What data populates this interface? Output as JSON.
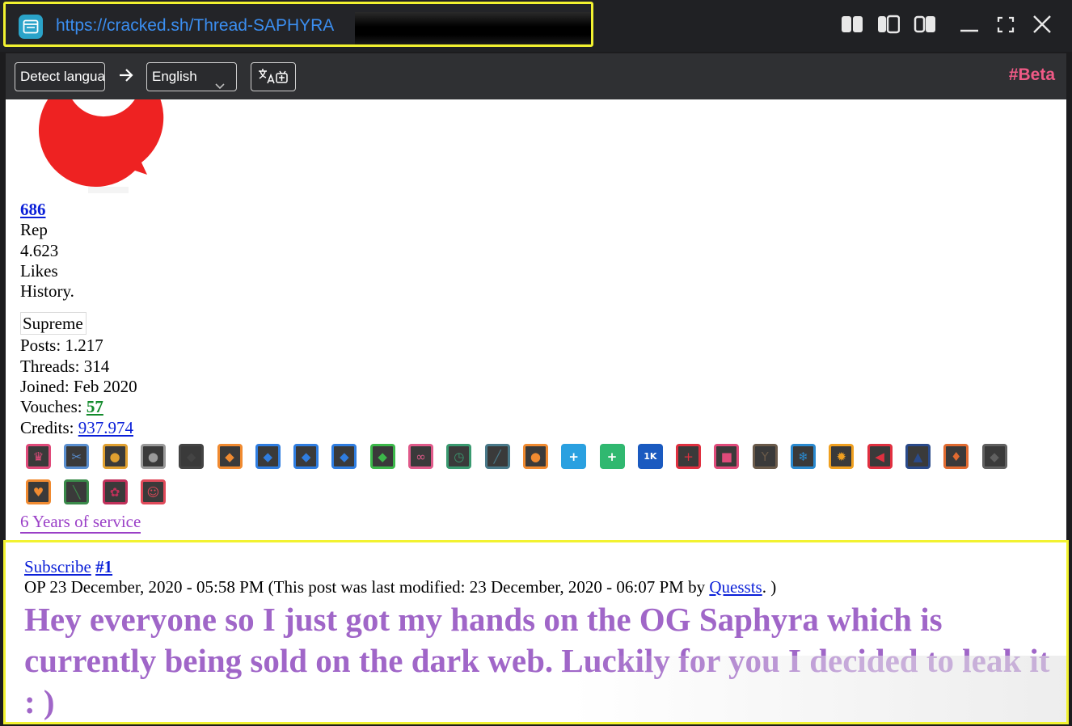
{
  "window": {
    "url": "https://cracked.sh/Thread-SAPHYRA",
    "controls": [
      "split-left-icon",
      "split-center-icon",
      "split-right-icon",
      "minimize-icon",
      "fullscreen-icon",
      "close-icon"
    ]
  },
  "translate": {
    "source_label": "Detect language",
    "target_label": "English",
    "beta_label": "#Beta"
  },
  "profile": {
    "rep_value": "686",
    "rep_label": "Rep",
    "likes_value": "4.623",
    "likes_label": "Likes",
    "history_label": "History.",
    "rank": "Supreme",
    "posts_label": "Posts:",
    "posts_value": "1.217",
    "threads_label": "Threads:",
    "threads_value": "314",
    "joined_label": "Joined:",
    "joined_value": "Feb 2020",
    "vouches_label": "Vouches:",
    "vouches_value": "57",
    "credits_label": "Credits:",
    "credits_value": "937.974",
    "service_label": "6 Years of service"
  },
  "badges": [
    {
      "icon": "throne-icon",
      "color": "#e04a7a"
    },
    {
      "icon": "tools-icon",
      "color": "#5a8fd0"
    },
    {
      "icon": "gold-coins-icon",
      "color": "#e0a030"
    },
    {
      "icon": "silver-coins-icon",
      "color": "#9a9a9a"
    },
    {
      "icon": "white-diamond-icon",
      "color": "#444444"
    },
    {
      "icon": "orange-diamond-icon",
      "color": "#f08a30"
    },
    {
      "icon": "blue-diamond-icon",
      "color": "#2f7de0"
    },
    {
      "icon": "blue-diamond-icon",
      "color": "#2f7de0"
    },
    {
      "icon": "blue-diamond-icon",
      "color": "#2f7de0"
    },
    {
      "icon": "green-diamond-icon",
      "color": "#3cb84a"
    },
    {
      "icon": "infinity-icon",
      "color": "#e05a8a"
    },
    {
      "icon": "stopwatch-icon",
      "color": "#3a9a70"
    },
    {
      "icon": "syringe-icon",
      "color": "#4a7a8a"
    },
    {
      "icon": "chat-bubble-icon",
      "color": "#f08a30"
    },
    {
      "icon": "plus-circle-icon",
      "color": "#2aa0e0"
    },
    {
      "icon": "plus-circle-icon",
      "color": "#30b870"
    },
    {
      "icon": "1k-icon",
      "color": "#1a5ac0"
    },
    {
      "icon": "medical-shield-icon",
      "color": "#e03040"
    },
    {
      "icon": "gift-icon",
      "color": "#e04a7a"
    },
    {
      "icon": "deer-icon",
      "color": "#6a5a4a"
    },
    {
      "icon": "snowflake-icon",
      "color": "#2a8ad0"
    },
    {
      "icon": "gear-sun-icon",
      "color": "#f0a020"
    },
    {
      "icon": "megaphone-icon",
      "color": "#e03040"
    },
    {
      "icon": "spy-icon",
      "color": "#2a4a8a"
    },
    {
      "icon": "crest-icon",
      "color": "#e06a30"
    },
    {
      "icon": "cube-icon",
      "color": "#606060"
    },
    {
      "icon": "heart-hand-icon",
      "color": "#f08a30"
    },
    {
      "icon": "champagne-icon",
      "color": "#3a8a4a"
    },
    {
      "icon": "flower-icon",
      "color": "#c0305a"
    },
    {
      "icon": "face-scan-icon",
      "color": "#e04a5a"
    }
  ],
  "post": {
    "subscribe_label": "Subscribe",
    "post_number": "#1",
    "meta_prefix": "OP 23 December, 2020 - 05:58 PM (This post was last modified: 23 December, 2020 - 06:07 PM by ",
    "modified_by": "Quessts",
    "meta_suffix": ". )",
    "body": "Hey everyone so I just got my hands on the OG Saphyra which is currently being sold on the dark web. Luckily for you I decided to leak it : )"
  }
}
